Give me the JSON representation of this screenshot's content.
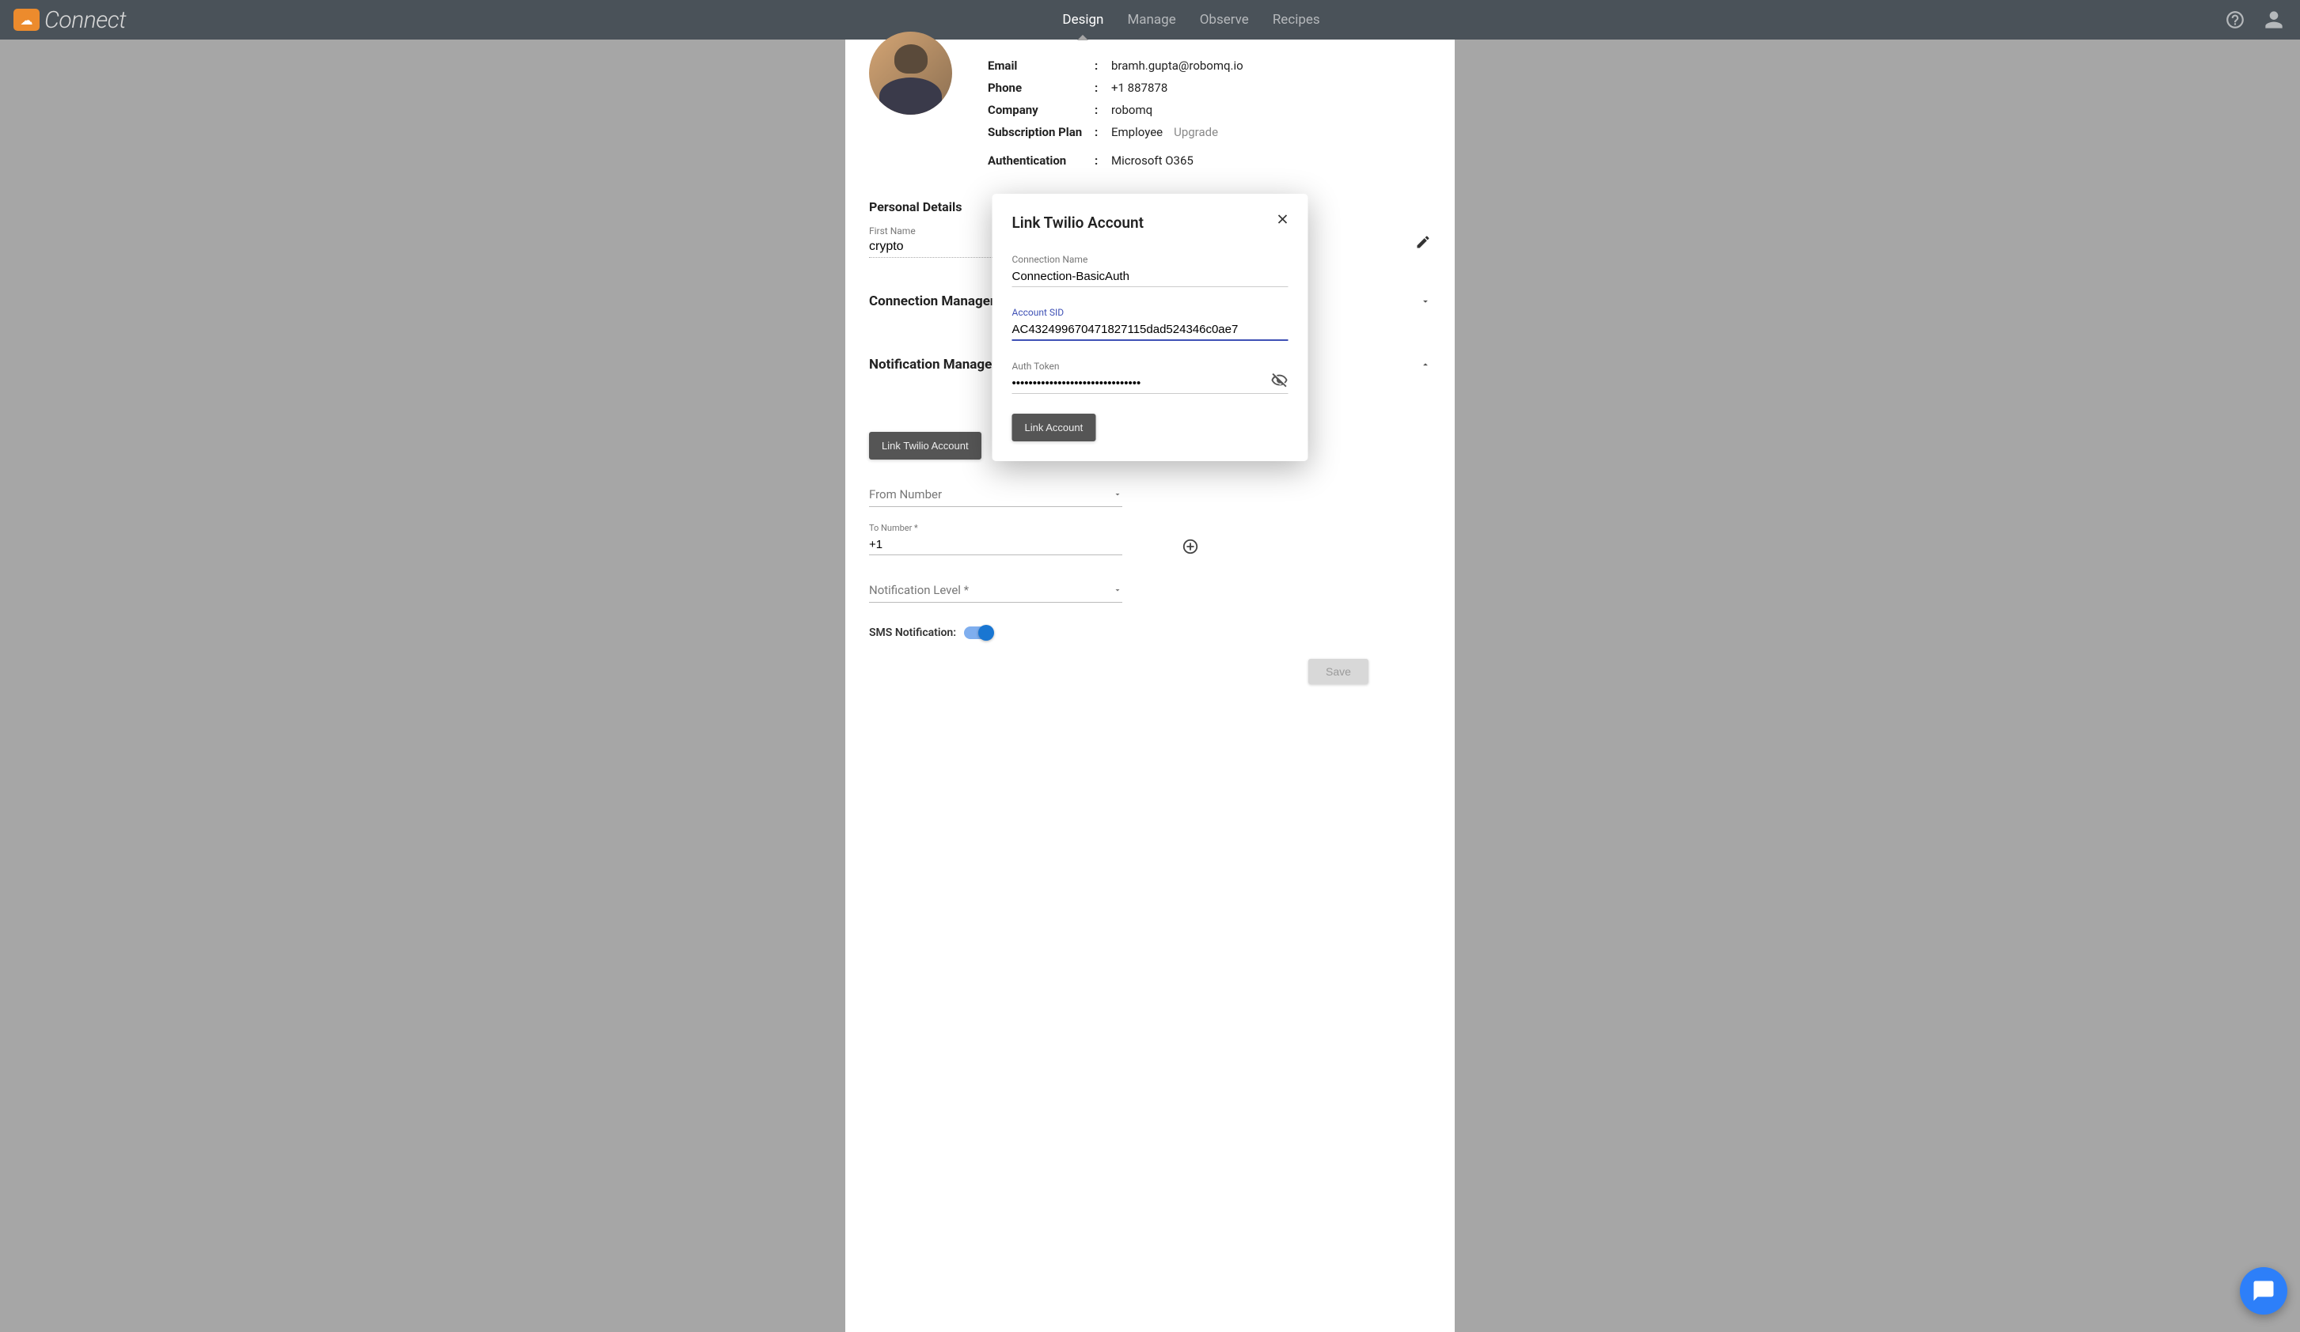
{
  "header": {
    "logo_text": "Connect",
    "tabs": {
      "design": "Design",
      "manage": "Manage",
      "observe": "Observe",
      "recipes": "Recipes"
    }
  },
  "profile": {
    "email_label": "Email",
    "email_value": "bramh.gupta@robomq.io",
    "phone_label": "Phone",
    "phone_value": "+1 887878",
    "company_label": "Company",
    "company_value": "robomq",
    "plan_label": "Subscription Plan",
    "plan_value": "Employee",
    "upgrade": "Upgrade",
    "auth_label": "Authentication",
    "auth_value": "Microsoft O365"
  },
  "personal": {
    "section_title": "Personal Details",
    "first_name_label": "First Name",
    "first_name_value": "crypto"
  },
  "panels": {
    "conn_mgmt": "Connection Management",
    "notif_mgmt": "Notification Management"
  },
  "notification": {
    "link_twilio_btn": "Link Twilio Account",
    "from_number_label": "From Number",
    "to_number_label": "To Number *",
    "to_number_value": "+1",
    "notif_level_label": "Notification Level *",
    "sms_label": "SMS Notification:",
    "save_label": "Save"
  },
  "modal": {
    "title": "Link Twilio Account",
    "conn_name_label": "Connection Name",
    "conn_name_value": "Connection-BasicAuth",
    "sid_label": "Account SID",
    "sid_value": "AC432499670471827115dad524346c0ae7",
    "token_label": "Auth Token",
    "token_value": "•••••••••••••••••••••••••••••••",
    "link_btn": "Link Account"
  }
}
